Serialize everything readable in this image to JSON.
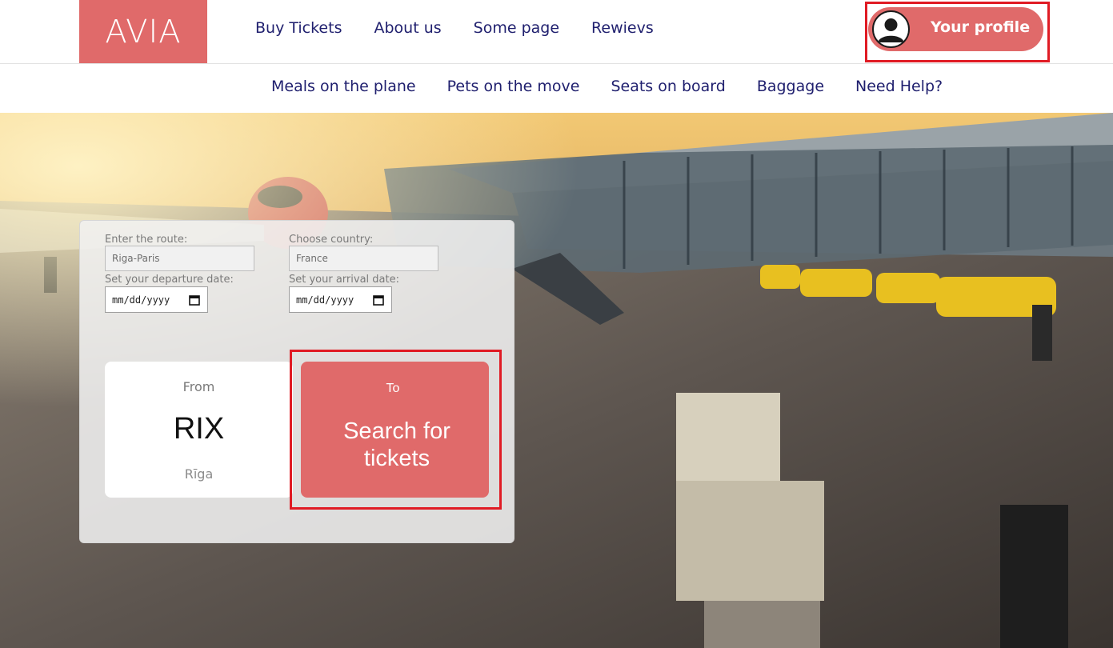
{
  "brand": {
    "logo": "AVIA",
    "accent_color": "#e06a6a",
    "nav_color": "#1f1f6e",
    "highlight_color": "#e01b24"
  },
  "main_nav": {
    "items": [
      {
        "label": "Buy Tickets"
      },
      {
        "label": "About us"
      },
      {
        "label": "Some page"
      },
      {
        "label": "Rewievs"
      }
    ]
  },
  "profile": {
    "label": "Your profile",
    "icon": "user-avatar-icon"
  },
  "sub_nav": {
    "items": [
      {
        "label": "Meals on the plane"
      },
      {
        "label": "Pets on the move"
      },
      {
        "label": "Seats on board"
      },
      {
        "label": "Baggage"
      },
      {
        "label": "Need Help?"
      }
    ]
  },
  "search_form": {
    "route_label": "Enter the route:",
    "route_value": "Riga-Paris",
    "country_label": "Choose country:",
    "country_value": "France",
    "departure_label": "Set your departure date:",
    "departure_placeholder": "mm/dd/yyyy",
    "arrival_label": "Set your arrival date:",
    "arrival_placeholder": "mm/dd/yyyy"
  },
  "from_card": {
    "caption": "From",
    "code": "RIX",
    "city": "Rīga"
  },
  "to_card": {
    "caption": "To",
    "action_line1": "Search for",
    "action_line2": "tickets"
  }
}
